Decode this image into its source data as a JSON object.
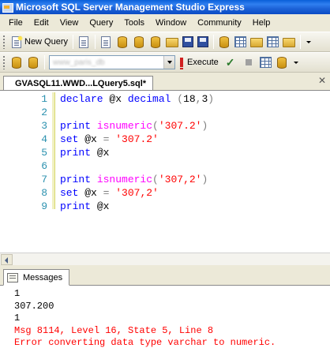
{
  "window": {
    "title": "Microsoft SQL Server Management Studio Express"
  },
  "menu": [
    "File",
    "Edit",
    "View",
    "Query",
    "Tools",
    "Window",
    "Community",
    "Help"
  ],
  "toolbar": {
    "new_query_label": "New Query",
    "database_value": "www_paris_db",
    "execute_label": "Execute"
  },
  "document_tab": {
    "title": "GVASQL11.WWD...LQuery5.sql*"
  },
  "editor": {
    "lines": [
      {
        "num": "1",
        "tokens": [
          {
            "t": "declare",
            "c": "kw"
          },
          {
            "t": " @x ",
            "c": ""
          },
          {
            "t": "decimal",
            "c": "kw"
          },
          {
            "t": " ",
            "c": ""
          },
          {
            "t": "(",
            "c": "op"
          },
          {
            "t": "18",
            "c": ""
          },
          {
            "t": ",",
            "c": "op"
          },
          {
            "t": "3",
            "c": ""
          },
          {
            "t": ")",
            "c": "op"
          }
        ]
      },
      {
        "num": "2",
        "tokens": []
      },
      {
        "num": "3",
        "tokens": [
          {
            "t": "print",
            "c": "kw"
          },
          {
            "t": " ",
            "c": ""
          },
          {
            "t": "isnumeric",
            "c": "fn"
          },
          {
            "t": "(",
            "c": "op"
          },
          {
            "t": "'307.2'",
            "c": "str"
          },
          {
            "t": ")",
            "c": "op"
          }
        ]
      },
      {
        "num": "4",
        "tokens": [
          {
            "t": "set",
            "c": "kw"
          },
          {
            "t": " @x ",
            "c": ""
          },
          {
            "t": "=",
            "c": "op"
          },
          {
            "t": " ",
            "c": ""
          },
          {
            "t": "'307.2'",
            "c": "str"
          }
        ]
      },
      {
        "num": "5",
        "tokens": [
          {
            "t": "print",
            "c": "kw"
          },
          {
            "t": " @x",
            "c": ""
          }
        ]
      },
      {
        "num": "6",
        "tokens": []
      },
      {
        "num": "7",
        "tokens": [
          {
            "t": "print",
            "c": "kw"
          },
          {
            "t": " ",
            "c": ""
          },
          {
            "t": "isnumeric",
            "c": "fn"
          },
          {
            "t": "(",
            "c": "op"
          },
          {
            "t": "'307,2'",
            "c": "str"
          },
          {
            "t": ")",
            "c": "op"
          }
        ]
      },
      {
        "num": "8",
        "tokens": [
          {
            "t": "set",
            "c": "kw"
          },
          {
            "t": " @x ",
            "c": ""
          },
          {
            "t": "=",
            "c": "op"
          },
          {
            "t": " ",
            "c": ""
          },
          {
            "t": "'307,2'",
            "c": "str"
          }
        ]
      },
      {
        "num": "9",
        "tokens": [
          {
            "t": "print",
            "c": "kw"
          },
          {
            "t": " @x",
            "c": ""
          }
        ]
      }
    ]
  },
  "results": {
    "tab_label": "Messages",
    "lines": [
      {
        "text": "1",
        "error": false
      },
      {
        "text": "307.200",
        "error": false
      },
      {
        "text": "1",
        "error": false
      },
      {
        "text": "Msg 8114, Level 16, State 5, Line 8",
        "error": true
      },
      {
        "text": "Error converting data type varchar to numeric.",
        "error": true
      }
    ]
  },
  "colors": {
    "keyword": "#0000ff",
    "function": "#ff00ff",
    "string": "#ff0000",
    "line_number": "#2b91af",
    "error": "#ff0000"
  }
}
